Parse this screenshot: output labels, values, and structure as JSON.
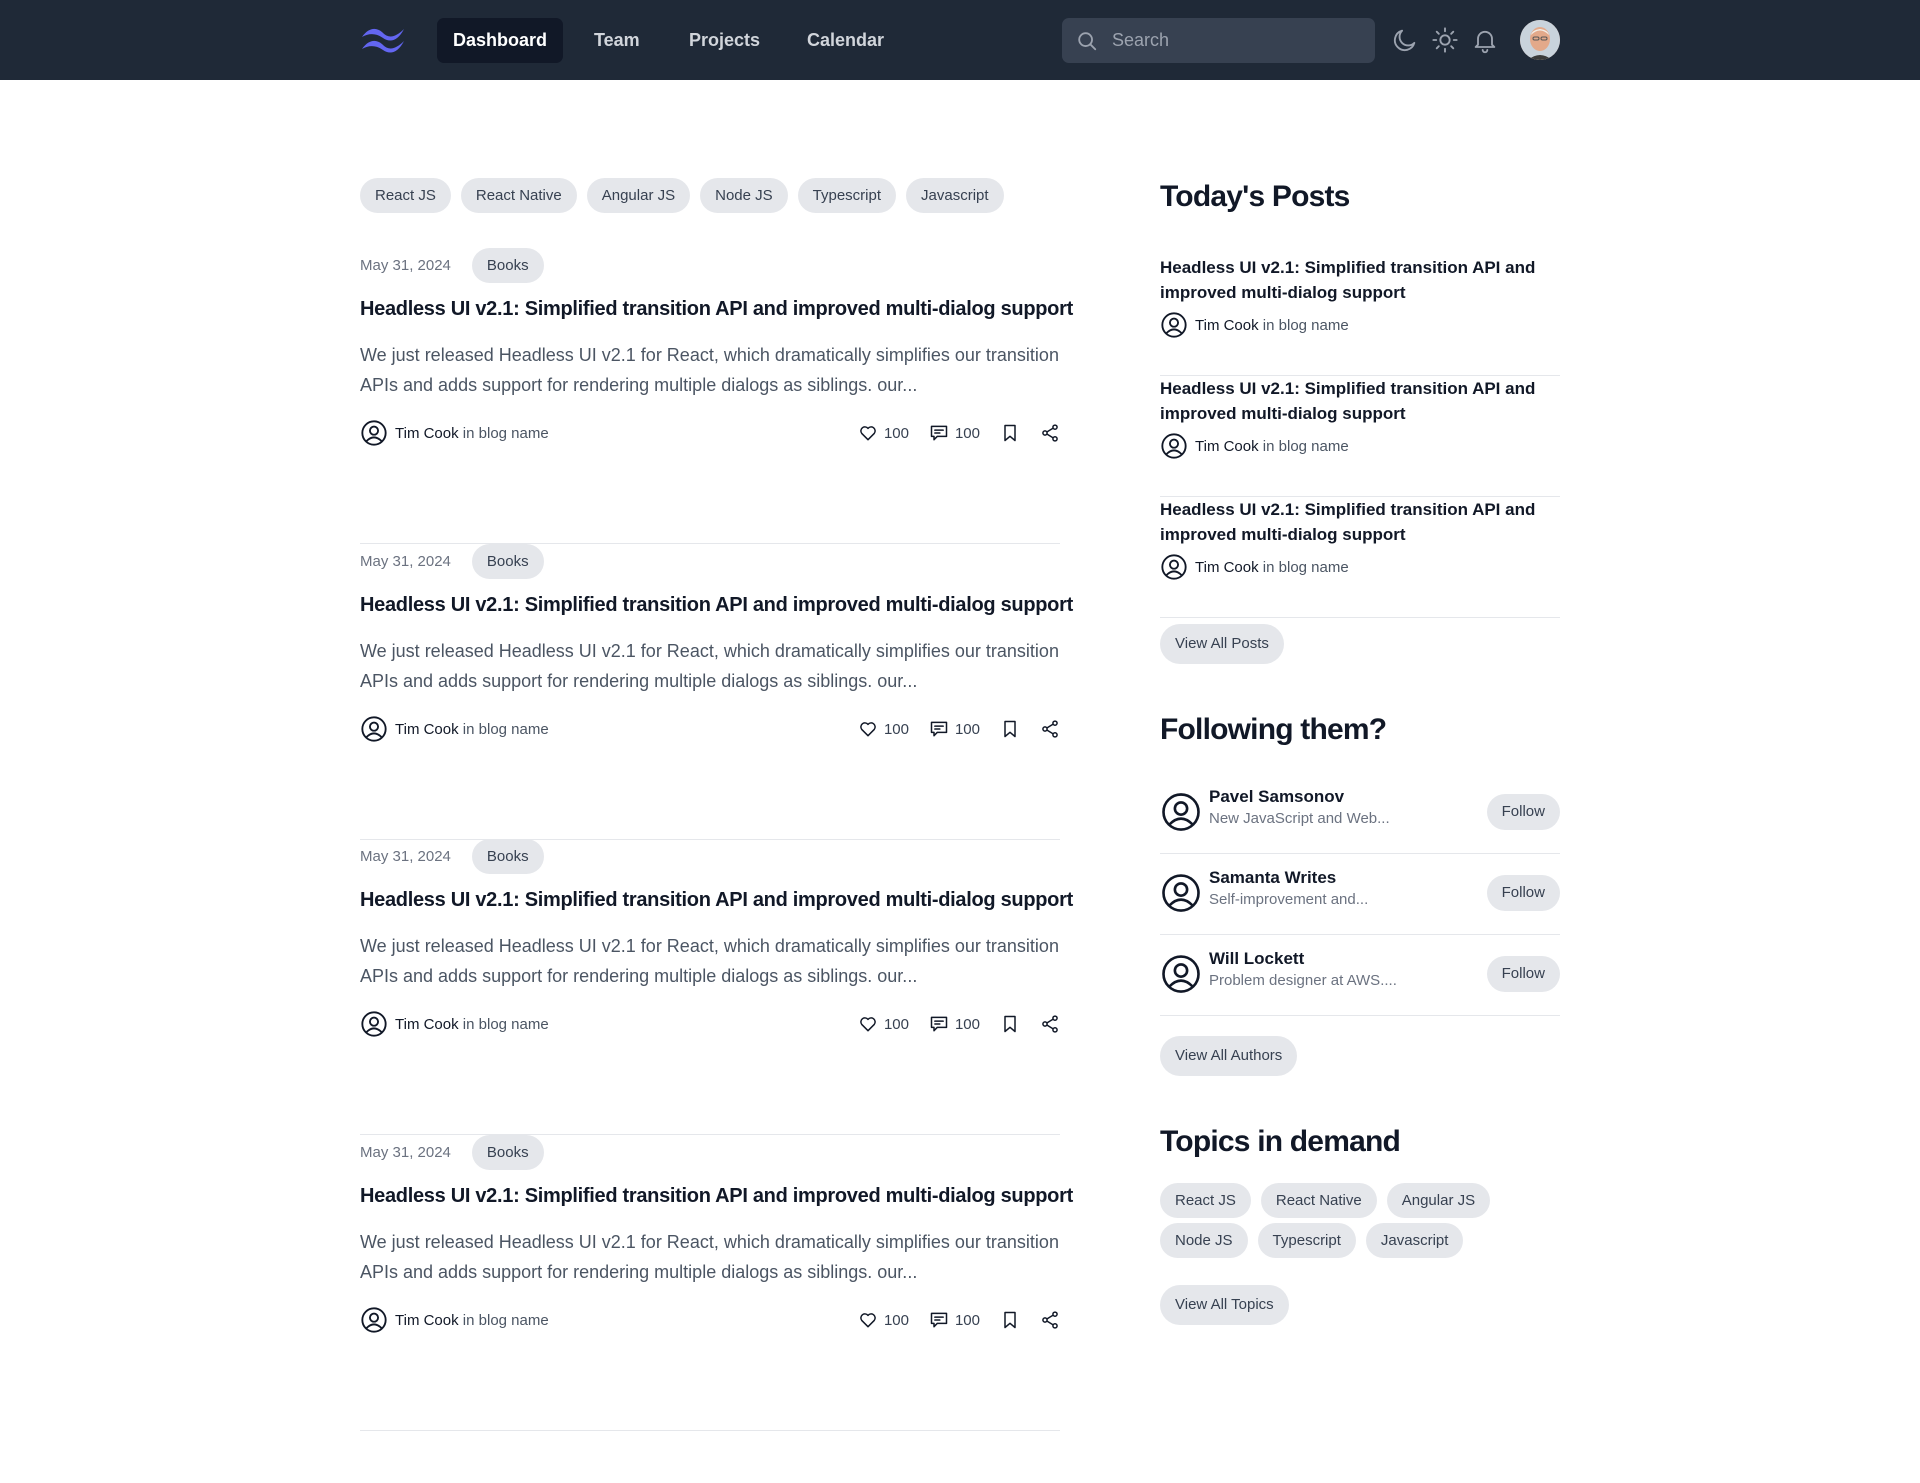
{
  "nav": {
    "items": [
      {
        "label": "Dashboard",
        "active": true
      },
      {
        "label": "Team",
        "active": false
      },
      {
        "label": "Projects",
        "active": false
      },
      {
        "label": "Calendar",
        "active": false
      }
    ],
    "search_placeholder": "Search"
  },
  "tags": [
    "React JS",
    "React Native",
    "Angular JS",
    "Node JS",
    "Typescript",
    "Javascript"
  ],
  "posts": [
    {
      "date": "May 31, 2024",
      "category": "Books",
      "title": "Headless UI v2.1: Simplified transition API and improved multi-dialog support",
      "excerpt": "We just released Headless UI v2.1 for React, which dramatically simplifies our transition APIs and adds support for rendering multiple dialogs as siblings. our...",
      "author": "Tim Cook",
      "in": "in",
      "blog": "blog name",
      "likes": "100",
      "comments": "100"
    },
    {
      "date": "May 31, 2024",
      "category": "Books",
      "title": "Headless UI v2.1: Simplified transition API and improved multi-dialog support",
      "excerpt": "We just released Headless UI v2.1 for React, which dramatically simplifies our transition APIs and adds support for rendering multiple dialogs as siblings. our...",
      "author": "Tim Cook",
      "in": "in",
      "blog": "blog name",
      "likes": "100",
      "comments": "100"
    },
    {
      "date": "May 31, 2024",
      "category": "Books",
      "title": "Headless UI v2.1: Simplified transition API and improved multi-dialog support",
      "excerpt": "We just released Headless UI v2.1 for React, which dramatically simplifies our transition APIs and adds support for rendering multiple dialogs as siblings. our...",
      "author": "Tim Cook",
      "in": "in",
      "blog": "blog name",
      "likes": "100",
      "comments": "100"
    },
    {
      "date": "May 31, 2024",
      "category": "Books",
      "title": "Headless UI v2.1: Simplified transition API and improved multi-dialog support",
      "excerpt": "We just released Headless UI v2.1 for React, which dramatically simplifies our transition APIs and adds support for rendering multiple dialogs as siblings. our...",
      "author": "Tim Cook",
      "in": "in",
      "blog": "blog name",
      "likes": "100",
      "comments": "100"
    }
  ],
  "todays_posts": {
    "heading": "Today's Posts",
    "items": [
      {
        "title": "Headless UI v2.1: Simplified transition API and improved multi-dialog support",
        "author": "Tim Cook",
        "in": "in",
        "blog": "blog name"
      },
      {
        "title": "Headless UI v2.1: Simplified transition API and improved multi-dialog support",
        "author": "Tim Cook",
        "in": "in",
        "blog": "blog name"
      },
      {
        "title": "Headless UI v2.1: Simplified transition API and improved multi-dialog support",
        "author": "Tim Cook",
        "in": "in",
        "blog": "blog name"
      }
    ],
    "view_all": "View All Posts"
  },
  "following": {
    "heading": "Following them?",
    "items": [
      {
        "name": "Pavel Samsonov",
        "desc": "New JavaScript and Web...",
        "button": "Follow"
      },
      {
        "name": "Samanta Writes",
        "desc": "Self-improvement and...",
        "button": "Follow"
      },
      {
        "name": "Will Lockett",
        "desc": "Problem designer at AWS....",
        "button": "Follow"
      }
    ],
    "view_all": "View All Authors"
  },
  "topics": {
    "heading": "Topics in demand",
    "items": [
      "React JS",
      "React Native",
      "Angular JS",
      "Node JS",
      "Typescript",
      "Javascript"
    ],
    "view_all": "View All Topics"
  },
  "colors": {
    "nav_bg": "#1f2937",
    "nav_active_bg": "#111827",
    "chip_bg": "#e5e7eb",
    "logo": "#6366f1"
  },
  "icons": {
    "logo": "tailwind-wave-logo",
    "search": "search-icon",
    "moon": "moon-icon",
    "sun": "sun-icon",
    "bell": "bell-icon",
    "user": "user-circle-icon",
    "heart": "heart-icon",
    "comment": "comment-icon",
    "bookmark": "bookmark-icon",
    "share": "share-icon"
  }
}
